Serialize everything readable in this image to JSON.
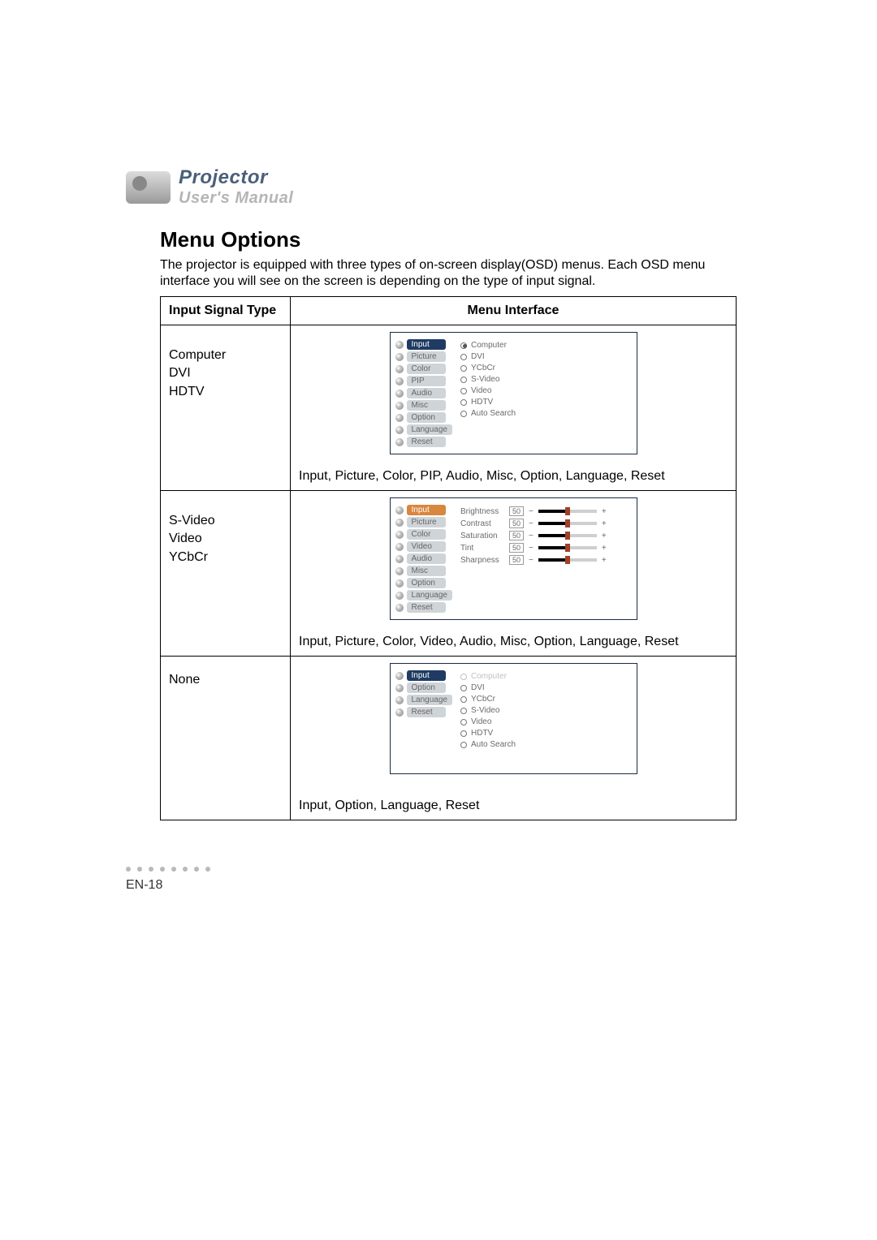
{
  "logo": {
    "line1": "Projector",
    "line2": "User's Manual"
  },
  "section_title": "Menu Options",
  "intro_text": "The projector is equipped with three types of on-screen display(OSD) menus. Each OSD menu interface you will see on the screen is depending on the type of  input signal.",
  "table": {
    "header_signal": "Input Signal Type",
    "header_interface": "Menu Interface",
    "rows": [
      {
        "signals": [
          "Computer",
          "DVI",
          "HDTV"
        ],
        "osd": {
          "left": [
            {
              "label": "Input",
              "style": "pill-blue-dark"
            },
            {
              "label": "Picture",
              "style": "pill-gray"
            },
            {
              "label": "Color",
              "style": "pill-gray"
            },
            {
              "label": "PIP",
              "style": "pill-gray"
            },
            {
              "label": "Audio",
              "style": "pill-gray"
            },
            {
              "label": "Misc",
              "style": "pill-gray"
            },
            {
              "label": "Option",
              "style": "pill-gray"
            },
            {
              "label": "Language",
              "style": "pill-gray"
            },
            {
              "label": "Reset",
              "style": "pill-gray"
            }
          ],
          "right_type": "radios",
          "right": [
            {
              "label": "Computer",
              "checked": true
            },
            {
              "label": "DVI",
              "checked": false
            },
            {
              "label": "YCbCr",
              "checked": false
            },
            {
              "label": "S-Video",
              "checked": false
            },
            {
              "label": "Video",
              "checked": false
            },
            {
              "label": "HDTV",
              "checked": false
            },
            {
              "label": "Auto Search",
              "checked": false
            }
          ]
        },
        "caption": "Input, Picture, Color, PIP, Audio, Misc, Option, Language, Reset"
      },
      {
        "signals": [
          "S-Video",
          "Video",
          "YCbCr"
        ],
        "osd": {
          "left": [
            {
              "label": "Input",
              "style": "pill-orange"
            },
            {
              "label": "Picture",
              "style": "pill-gray"
            },
            {
              "label": "Color",
              "style": "pill-gray"
            },
            {
              "label": "Video",
              "style": "pill-gray"
            },
            {
              "label": "Audio",
              "style": "pill-gray"
            },
            {
              "label": "Misc",
              "style": "pill-gray"
            },
            {
              "label": "Option",
              "style": "pill-gray"
            },
            {
              "label": "Language",
              "style": "pill-gray"
            },
            {
              "label": "Reset",
              "style": "pill-gray"
            }
          ],
          "right_type": "sliders",
          "right": [
            {
              "label": "Brightness",
              "value": "50"
            },
            {
              "label": "Contrast",
              "value": "50"
            },
            {
              "label": "Saturation",
              "value": "50"
            },
            {
              "label": "Tint",
              "value": "50"
            },
            {
              "label": "Sharpness",
              "value": "50"
            }
          ]
        },
        "caption": "Input, Picture, Color, Video, Audio, Misc, Option, Language, Reset"
      },
      {
        "signals": [
          "None"
        ],
        "osd": {
          "left": [
            {
              "label": "Input",
              "style": "pill-blue-dark"
            },
            {
              "label": "Option",
              "style": "pill-gray"
            },
            {
              "label": "Language",
              "style": "pill-gray"
            },
            {
              "label": "Reset",
              "style": "pill-gray"
            }
          ],
          "right_type": "radios",
          "right": [
            {
              "label": "Computer",
              "checked": false,
              "disabled": true
            },
            {
              "label": "DVI",
              "checked": false
            },
            {
              "label": "YCbCr",
              "checked": false
            },
            {
              "label": "S-Video",
              "checked": false
            },
            {
              "label": "Video",
              "checked": false
            },
            {
              "label": "HDTV",
              "checked": false
            },
            {
              "label": "Auto Search",
              "checked": false
            }
          ]
        },
        "caption": "Input, Option, Language, Reset"
      }
    ]
  },
  "page_number": "EN-18",
  "symbols": {
    "minus": "−",
    "plus": "+"
  }
}
